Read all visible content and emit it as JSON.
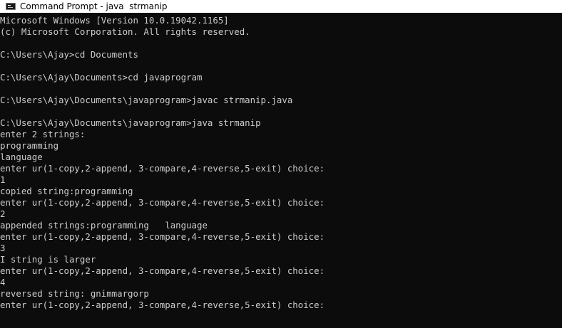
{
  "window": {
    "title": "Command Prompt - java  strmanip",
    "icon": "console-icon"
  },
  "console": {
    "lines": [
      "Microsoft Windows [Version 10.0.19042.1165]",
      "(c) Microsoft Corporation. All rights reserved.",
      "",
      "C:\\Users\\Ajay>cd Documents",
      "",
      "C:\\Users\\Ajay\\Documents>cd javaprogram",
      "",
      "C:\\Users\\Ajay\\Documents\\javaprogram>javac strmanip.java",
      "",
      "C:\\Users\\Ajay\\Documents\\javaprogram>java strmanip",
      "enter 2 strings:",
      "programming",
      "language",
      "enter ur(1-copy,2-append, 3-compare,4-reverse,5-exit) choice:",
      "1",
      "copied string:programming",
      "enter ur(1-copy,2-append, 3-compare,4-reverse,5-exit) choice:",
      "2",
      "appended strings:programming   language",
      "enter ur(1-copy,2-append, 3-compare,4-reverse,5-exit) choice:",
      "3",
      "I string is larger",
      "enter ur(1-copy,2-append, 3-compare,4-reverse,5-exit) choice:",
      "4",
      "reversed string: gnimmargorp",
      "enter ur(1-copy,2-append, 3-compare,4-reverse,5-exit) choice:"
    ]
  }
}
